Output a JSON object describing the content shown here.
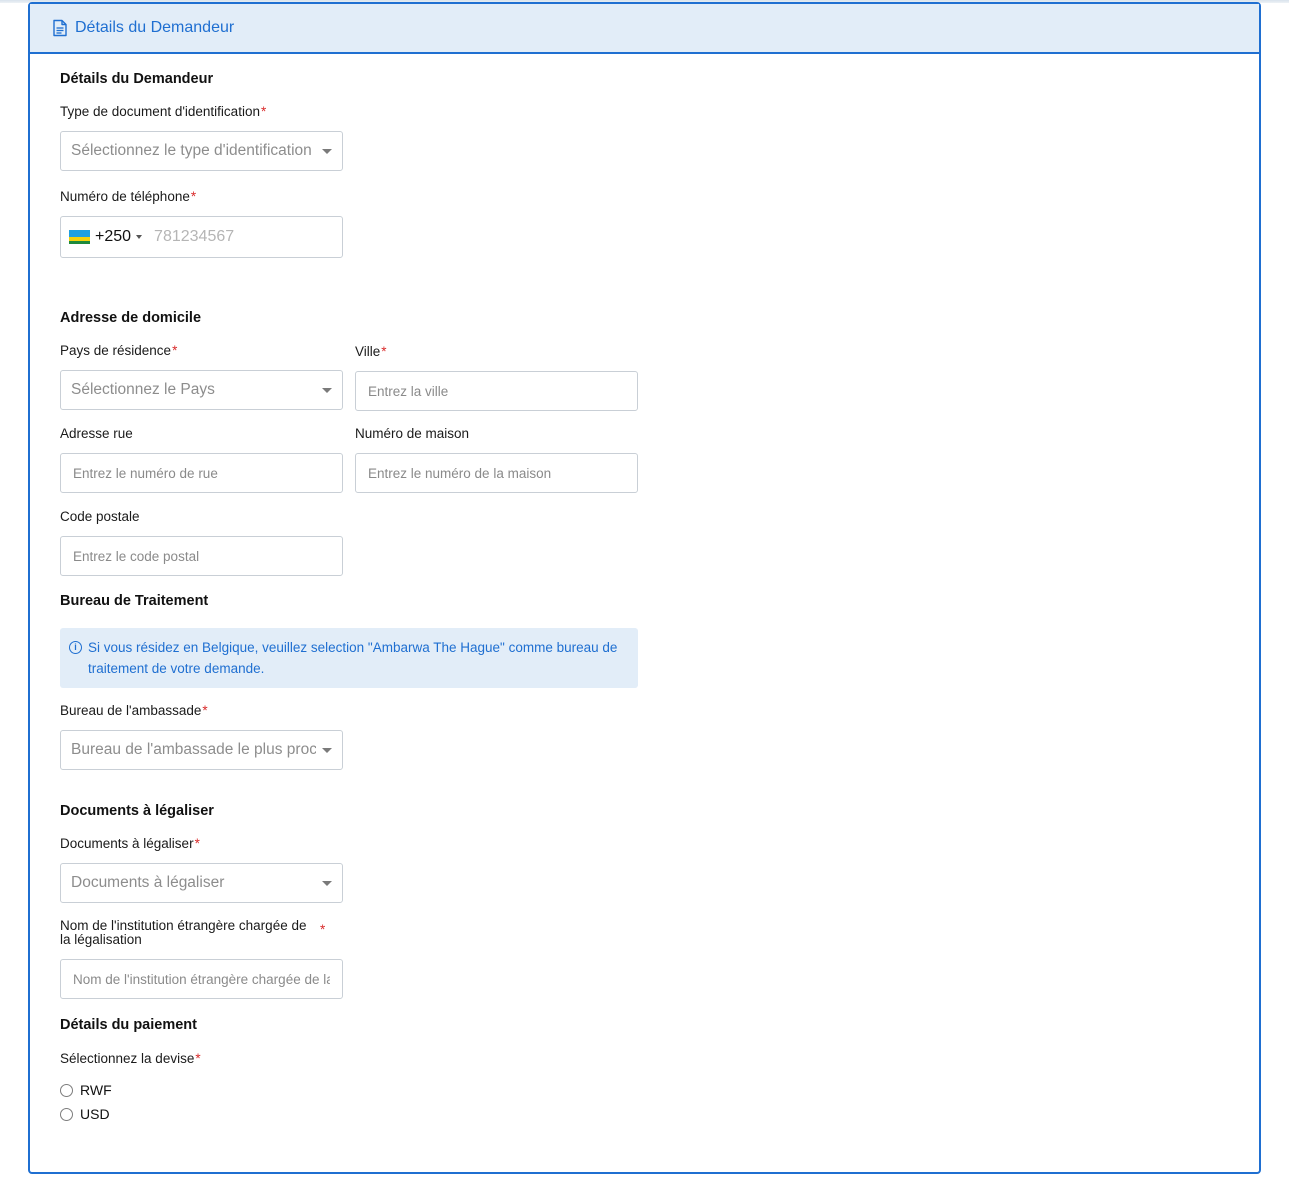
{
  "header": {
    "title": "Détails du Demandeur"
  },
  "applicant": {
    "section_title": "Détails du Demandeur",
    "id_type": {
      "label": "Type de document d'identification",
      "required": "*",
      "placeholder": "Sélectionnez le type d'identification"
    },
    "phone": {
      "label": "Numéro de téléphone",
      "required": "*",
      "dial_code": "+250",
      "placeholder": "781234567"
    }
  },
  "address": {
    "section_title": "Adresse de domicile",
    "country": {
      "label": "Pays de résidence",
      "required": "*",
      "placeholder": "Sélectionnez le Pays"
    },
    "city": {
      "label": "Ville",
      "required": "*",
      "placeholder": "Entrez la ville"
    },
    "street": {
      "label": "Adresse rue",
      "placeholder": "Entrez le numéro de rue"
    },
    "house_number": {
      "label": "Numéro de maison",
      "placeholder": "Entrez le numéro de la maison"
    },
    "postal_code": {
      "label": "Code postale",
      "placeholder": "Entrez le code postal"
    }
  },
  "processing": {
    "section_title": "Bureau de Traitement",
    "info": "Si vous résidez en Belgique, veuillez selection \"Ambarwa The Hague\" comme bureau de traitement de votre demande.",
    "embassy": {
      "label": "Bureau de l'ambassade",
      "required": "*",
      "placeholder": "Bureau de l'ambassade le plus proche"
    }
  },
  "documents": {
    "section_title": "Documents à légaliser",
    "docs": {
      "label": "Documents à légaliser",
      "required": "*",
      "placeholder": "Documents à légaliser"
    },
    "institution": {
      "label": "Nom de l'institution étrangère chargée de la légalisation",
      "required": "*",
      "placeholder": "Nom de l'institution étrangère chargée de la légalisation"
    }
  },
  "payment": {
    "section_title": "Détails du paiement",
    "currency": {
      "label": "Sélectionnez la devise",
      "required": "*",
      "options": [
        "RWF",
        "USD"
      ]
    }
  },
  "colors": {
    "accent": "#1f6fd1",
    "header_bg": "#e2edf8",
    "required": "#d92b2b"
  }
}
